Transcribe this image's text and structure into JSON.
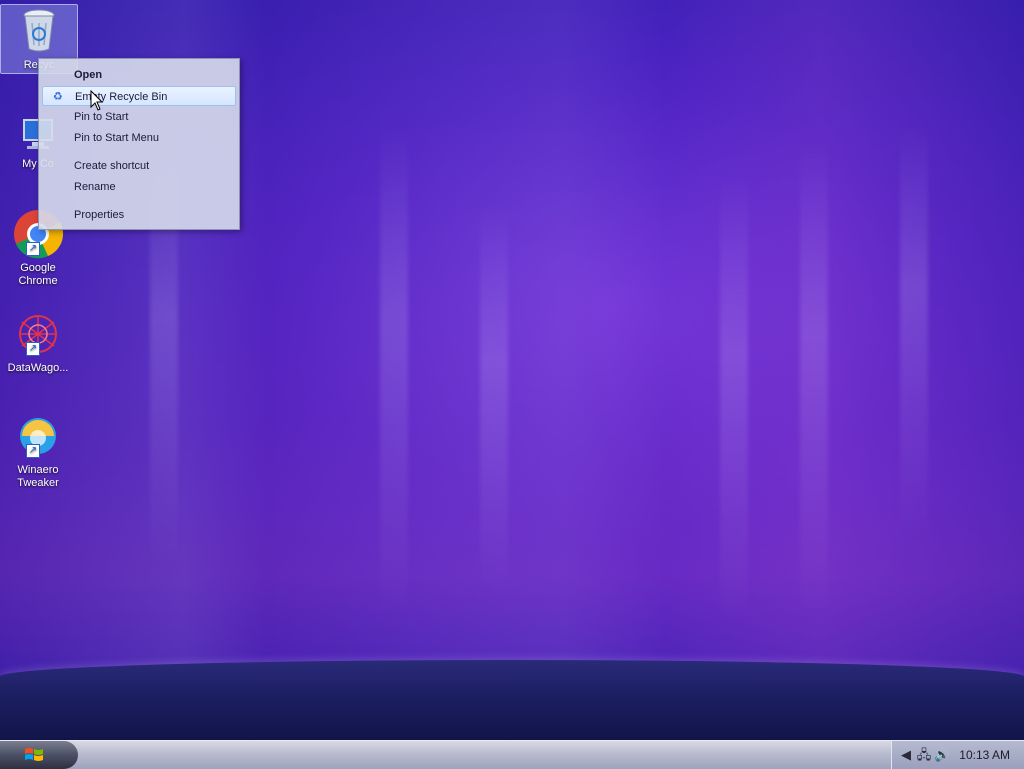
{
  "desktop": {
    "icons": [
      {
        "label": "Recyc",
        "icon": "recycle-bin-icon"
      },
      {
        "label": "My Co",
        "icon": "computer-icon"
      },
      {
        "label": "Google Chrome",
        "icon": "chrome-icon"
      },
      {
        "label": "DataWago...",
        "icon": "datawago-icon"
      },
      {
        "label": "Winaero Tweaker",
        "icon": "winaero-tweaker-icon"
      }
    ]
  },
  "context_menu": {
    "items": [
      {
        "label": "Open",
        "bold": true
      },
      {
        "label": "Empty Recycle Bin",
        "icon": "recycle-bin-small-icon",
        "highlighted": true
      },
      {
        "label": "Pin to Start"
      },
      {
        "label": "Pin to Start Menu"
      },
      {
        "label": "Create shortcut"
      },
      {
        "label": "Rename"
      },
      {
        "label": "Properties"
      }
    ]
  },
  "taskbar": {
    "start_icon": "windows-flag-icon",
    "tray": {
      "icons": [
        "expand-tray-icon",
        "network-icon",
        "volume-icon"
      ],
      "clock": "10:13 AM"
    }
  },
  "colors": {
    "wallpaper": "#4a23c2",
    "menu_bg": "#d6dbeb",
    "highlight": "#d6e6ff"
  }
}
